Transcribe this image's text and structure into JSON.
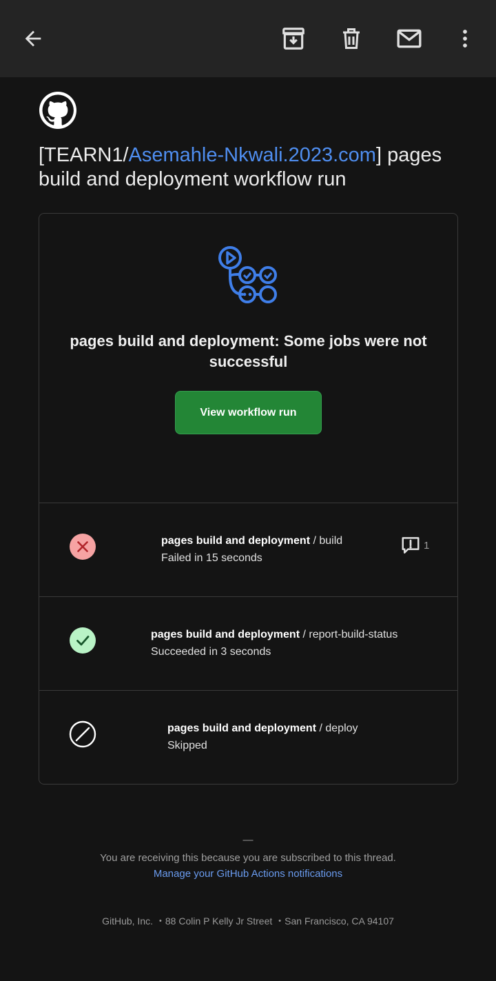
{
  "toolbar": {
    "back_icon": "arrow-back-icon",
    "archive_icon": "archive-icon",
    "delete_icon": "trash-icon",
    "mark_unread_icon": "mail-icon",
    "more_icon": "more-vertical-icon"
  },
  "email": {
    "sender_logo": "github-logo",
    "subject_prefix": "[TEARN1/",
    "subject_repo": "Asemahle-Nkwali.2023.com",
    "subject_suffix": "] pages build and deployment workflow run"
  },
  "card": {
    "title": "pages build and deployment: Some jobs were not successful",
    "button_label": "View workflow run",
    "jobs": [
      {
        "workflow": "pages build and deployment",
        "separator": " / ",
        "job": "build",
        "status": "Failed in 15 seconds",
        "state": "failed",
        "annotation_count": "1"
      },
      {
        "workflow": "pages build and deployment",
        "separator": " / ",
        "job": "report-build-status",
        "status": "Succeeded in 3 seconds",
        "state": "success"
      },
      {
        "workflow": "pages build and deployment",
        "separator": " / ",
        "job": "deploy",
        "status": "Skipped",
        "state": "skipped"
      }
    ]
  },
  "footer": {
    "dash": "—",
    "receiving": "You are receiving this because you are subscribed to this thread.",
    "manage_link": "Manage your GitHub Actions notifications",
    "address": "GitHub, Inc.  ・88 Colin P Kelly Jr Street  ・San Francisco, CA 94107"
  },
  "colors": {
    "accent_link": "#4f8ef0",
    "button_green": "#238636",
    "fail_bg": "#f6a3a3",
    "success_bg": "#b9f3c6"
  }
}
